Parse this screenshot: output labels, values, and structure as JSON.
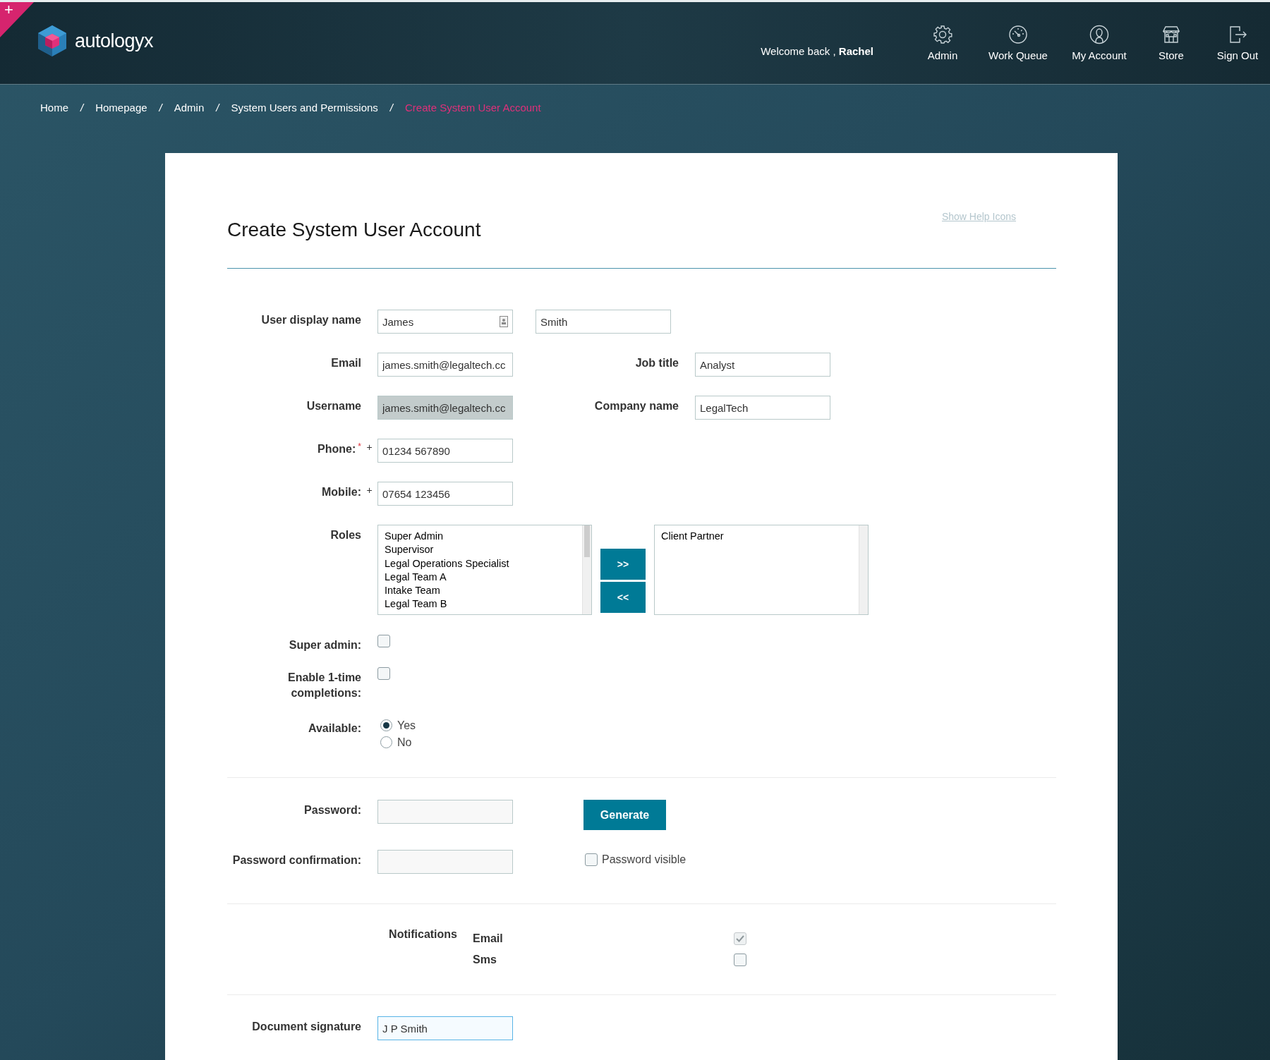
{
  "corner_badge": "+",
  "header": {
    "logo_text": "autologyx",
    "welcome": "Welcome back ,",
    "user": "Rachel",
    "nav": [
      {
        "label": "Admin",
        "kind": "gear"
      },
      {
        "label": "Work Queue",
        "kind": "gauge"
      },
      {
        "label": "My Account",
        "kind": "person"
      },
      {
        "label": "Store",
        "kind": "store"
      },
      {
        "label": "Sign Out",
        "kind": "exit"
      }
    ]
  },
  "breadcrumb": [
    {
      "label": "Home",
      "current": false,
      "separator": "/"
    },
    {
      "label": "Homepage",
      "current": false,
      "separator": "/"
    },
    {
      "label": "Admin",
      "current": false,
      "separator": "/"
    },
    {
      "label": "System Users and Permissions",
      "current": false,
      "separator": "/"
    },
    {
      "label": "Create System User Account",
      "current": true
    }
  ],
  "form": {
    "title": "Create System User Account",
    "help_link": "Show Help Icons",
    "display_name": {
      "label": "User display name",
      "first": "James",
      "last": "Smith"
    },
    "rows": [
      {
        "kind": "pair",
        "label": "Email",
        "value": "james.smith@legaltech.cc",
        "disabled": false,
        "side_label": "Job title",
        "side_value": "Analyst"
      },
      {
        "kind": "pair",
        "label": "Username",
        "value": "james.smith@legaltech.cc",
        "disabled": true,
        "side_label": "Company name",
        "side_value": "LegalTech"
      },
      {
        "kind": "phone",
        "label": "Phone:",
        "required_mark": "*",
        "prefix": "+",
        "value": "01234 567890"
      },
      {
        "kind": "phone",
        "label": "Mobile:",
        "prefix": "+",
        "value": "07654 123456"
      }
    ],
    "roles": {
      "label": "Roles",
      "available": [
        "Super Admin",
        "Supervisor",
        "Legal Operations Specialist",
        "Legal Team A",
        "Intake Team",
        "Legal Team B"
      ],
      "add_button": ">>",
      "remove_button": "<<",
      "assigned": [
        "Client Partner"
      ]
    },
    "checkboxes": [
      {
        "label": "Super admin:",
        "checked": false
      },
      {
        "label": "Enable 1-time completions:",
        "checked": false
      }
    ],
    "available": {
      "label": "Available:",
      "options": [
        {
          "label": "Yes",
          "selected": true
        },
        {
          "label": "No",
          "selected": false
        }
      ]
    },
    "password": {
      "label": "Password:",
      "generate_button": "Generate",
      "confirm_label": "Password confirmation:",
      "visible_toggle": {
        "label": "Password visible",
        "checked": false
      }
    },
    "notifications": {
      "label": "Notifications",
      "channels": [
        {
          "label": "Email",
          "checked": true,
          "disabled": true
        },
        {
          "label": "Sms",
          "checked": false,
          "disabled": false
        }
      ]
    },
    "signature": {
      "label": "Document signature",
      "value": "J P Smith",
      "focused": true
    }
  }
}
